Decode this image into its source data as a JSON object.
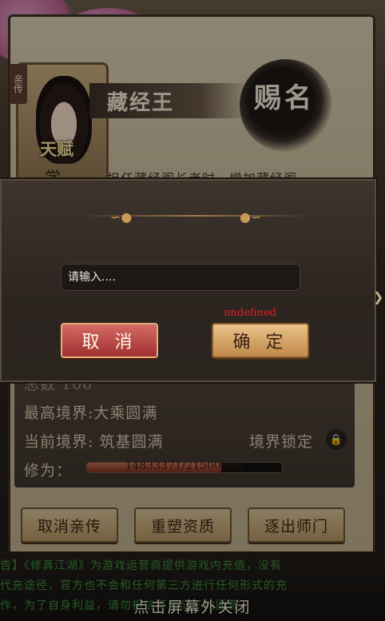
{
  "hero": {
    "tag": "亲传",
    "talent_heading": "天赋",
    "name": "藏经王",
    "seal": "赐名",
    "talent_prefix": "学",
    "talent_desc": "担任藏经阁长老时，增加藏经阁"
  },
  "stats": {
    "total_partial": "总数 100",
    "highest_realm": "最高境界:大乘圆满",
    "current_realm": "当前境界: 筑基圆满",
    "realm_lock": "境界锁定",
    "cultivation_label": "修为：",
    "cultivation_value": "14833371/21500900",
    "cultivation_progress": 0.69
  },
  "actions": {
    "cancel_disciple": "取消亲传",
    "reshape": "重塑资质",
    "expel": "逐出师门"
  },
  "dialog": {
    "input_placeholder": "请输入....",
    "input_value": "",
    "cancel": "取 消",
    "confirm": "确 定",
    "error_text": "undefined"
  },
  "footer": {
    "notice_line1": "告】《修真江湖》为游戏运营商提供游戏内充值，没有",
    "notice_line2": "代充途径，官方也不会和任何第三方进行任何形式的充",
    "notice_line3": "作，为了自身利益，请勿相信不法分子的圈套。",
    "close_hint": "点击屏幕外关闭"
  }
}
